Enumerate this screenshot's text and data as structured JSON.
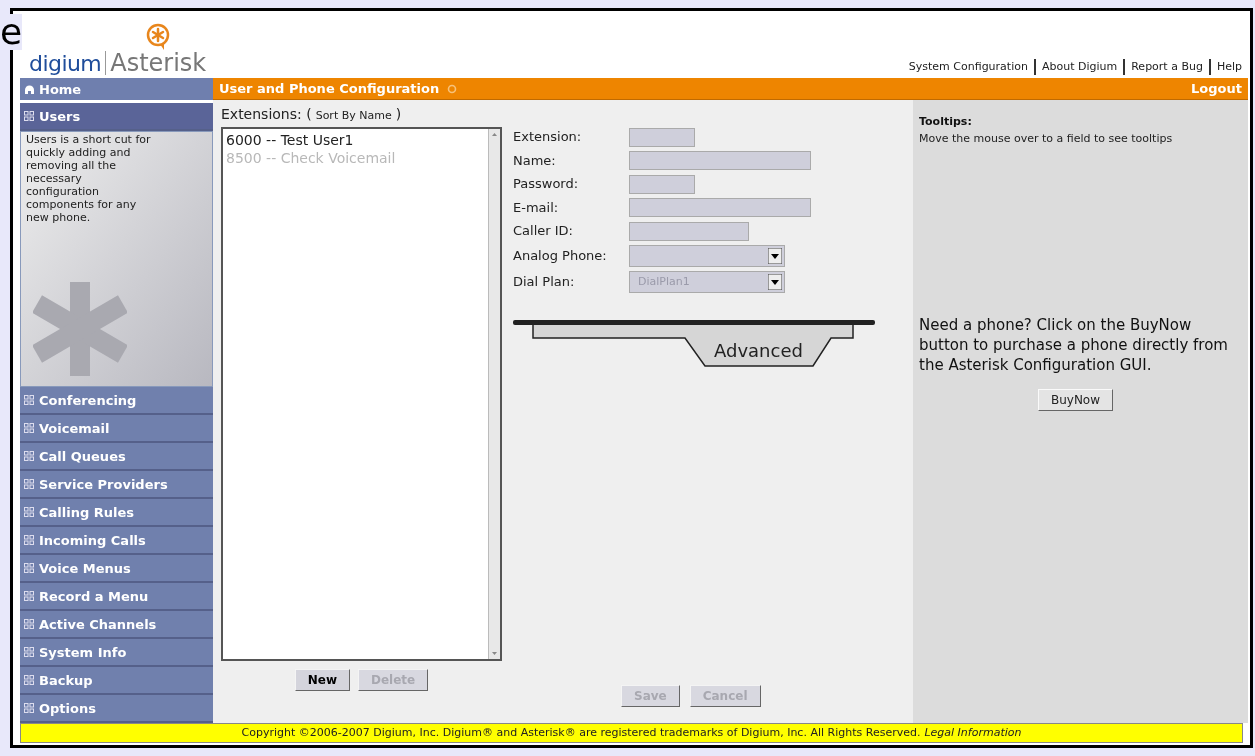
{
  "fragment": "e",
  "logo": {
    "brand": "digium",
    "product": "Asterisk"
  },
  "top_links": [
    "System Configuration",
    "About Digium",
    "Report a Bug",
    "Help"
  ],
  "sidebar": {
    "home": "Home",
    "description": "Users is a short cut for quickly adding and removing all the necessary configuration components for any new phone.",
    "items": [
      {
        "label": "Users",
        "selected": true
      },
      {
        "label": "Conferencing",
        "selected": false
      },
      {
        "label": "Voicemail",
        "selected": false
      },
      {
        "label": "Call Queues",
        "selected": false
      },
      {
        "label": "Service Providers",
        "selected": false
      },
      {
        "label": "Calling Rules",
        "selected": false
      },
      {
        "label": "Incoming Calls",
        "selected": false
      },
      {
        "label": "Voice Menus",
        "selected": false
      },
      {
        "label": "Record a Menu",
        "selected": false
      },
      {
        "label": "Active Channels",
        "selected": false
      },
      {
        "label": "System Info",
        "selected": false
      },
      {
        "label": "Backup",
        "selected": false
      },
      {
        "label": "Options",
        "selected": false
      }
    ]
  },
  "header": {
    "title": "User and Phone Configuration",
    "logout": "Logout"
  },
  "extensions": {
    "label": "Extensions: (",
    "sort": "Sort By Name",
    "close": ")",
    "items": [
      {
        "text": "6000 -- Test User1",
        "disabled": false
      },
      {
        "text": "8500 -- Check Voicemail",
        "disabled": true
      }
    ],
    "buttons": [
      {
        "label": "New",
        "disabled": false
      },
      {
        "label": "Delete",
        "disabled": true
      }
    ]
  },
  "form": {
    "fields": [
      {
        "label": "Extension:",
        "kind": "short"
      },
      {
        "label": "Name:",
        "kind": "long"
      },
      {
        "label": "Password:",
        "kind": "short"
      },
      {
        "label": "E-mail:",
        "kind": "long"
      },
      {
        "label": "Caller ID:",
        "kind": "medium"
      },
      {
        "label": "Analog Phone:",
        "kind": "select"
      },
      {
        "label": "Dial Plan:",
        "kind": "select",
        "value": "DialPlan1",
        "disabled": true
      }
    ],
    "advanced": "Advanced",
    "buttons": [
      {
        "label": "Save",
        "disabled": true
      },
      {
        "label": "Cancel",
        "disabled": true
      }
    ]
  },
  "tooltips": {
    "title": "Tooltips:",
    "text": "Move the mouse over to a field to see tooltips"
  },
  "promo": {
    "text": "Need a phone? Click on the BuyNow button to purchase a phone directly from the Asterisk Configuration GUI.",
    "button": "BuyNow"
  },
  "footer": {
    "text": "Copyright ©2006-2007 Digium, Inc. Digium® and Asterisk® are registered trademarks of Digium, Inc. All Rights Reserved.",
    "link": "Legal Information"
  }
}
